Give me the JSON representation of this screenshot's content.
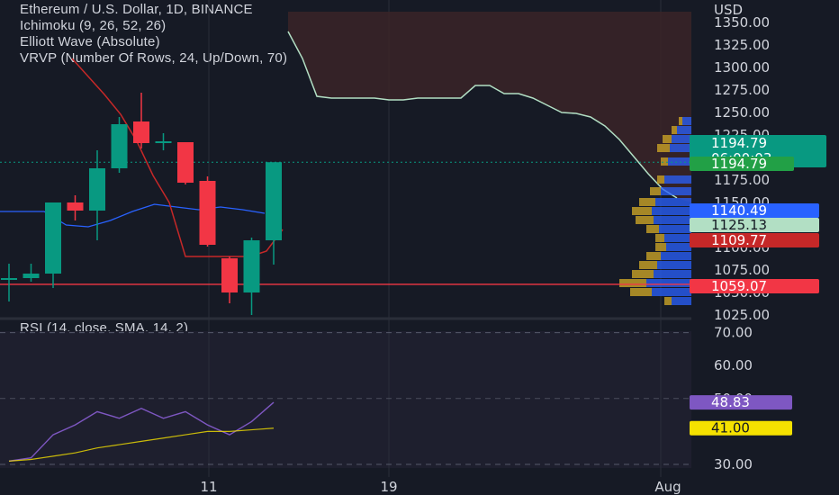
{
  "header": {
    "title": "Ethereum / U.S. Dollar, 1D, BINANCE",
    "indicators": [
      "Ichimoku (9, 26, 52, 26)",
      "Elliott Wave (Absolute)",
      "VRVP (Number Of Rows, 24, Up/Down, 70)"
    ]
  },
  "rsi_label": "RSI (14, close, SMA, 14, 2)",
  "currency": "USD",
  "price_ticks": [
    "1350.00",
    "1325.00",
    "1300.00",
    "1275.00",
    "1250.00",
    "1225.00",
    "1175.00",
    "1150.00",
    "1100.00",
    "1075.00",
    "1050.00",
    "1025.00"
  ],
  "rsi_ticks": [
    "70.00",
    "60.00",
    "50.00",
    "30.00"
  ],
  "x_ticks": [
    "11",
    "19",
    "Aug"
  ],
  "badges": [
    {
      "text": "1194.79",
      "sub": "06:00:03",
      "bg": "#089981",
      "fg": "#ffffff"
    },
    {
      "text": "1194.79",
      "bg": "#22a046",
      "fg": "#ffffff"
    },
    {
      "text": "1140.49",
      "bg": "#2962ff",
      "fg": "#ffffff"
    },
    {
      "text": "1125.13",
      "bg": "#b2dfc4",
      "fg": "#131722"
    },
    {
      "text": "1109.77",
      "bg": "#c62828",
      "fg": "#ffffff"
    },
    {
      "text": "1059.07",
      "bg": "#f23645",
      "fg": "#ffffff"
    }
  ],
  "rsi_badges": [
    {
      "text": "48.83",
      "bg": "#7e57c2",
      "fg": "#ffffff"
    },
    {
      "text": "41.00",
      "bg": "#f5e100",
      "fg": "#131722"
    }
  ],
  "colors": {
    "up": "#089981",
    "down": "#f23645",
    "background": "#161a25",
    "grid": "#2a2e39",
    "axis_text": "#d1d4dc"
  },
  "chart_data": {
    "type": "candlestick",
    "symbol": "Ethereum / U.S. Dollar",
    "timeframe": "1D",
    "exchange": "BINANCE",
    "ylim": [
      1020,
      1362
    ],
    "candles": [
      {
        "o": 1064,
        "h": 1082,
        "l": 1040,
        "c": 1066
      },
      {
        "o": 1066,
        "h": 1082,
        "l": 1062,
        "c": 1071
      },
      {
        "o": 1071,
        "h": 1150,
        "l": 1055,
        "c": 1150
      },
      {
        "o": 1150,
        "h": 1158,
        "l": 1130,
        "c": 1141
      },
      {
        "o": 1141,
        "h": 1208,
        "l": 1108,
        "c": 1188
      },
      {
        "o": 1188,
        "h": 1245,
        "l": 1183,
        "c": 1237
      },
      {
        "o": 1240,
        "h": 1272,
        "l": 1210,
        "c": 1216
      },
      {
        "o": 1216,
        "h": 1227,
        "l": 1208,
        "c": 1218
      },
      {
        "o": 1217,
        "h": 1217,
        "l": 1170,
        "c": 1172
      },
      {
        "o": 1174,
        "h": 1179,
        "l": 1101,
        "c": 1103
      },
      {
        "o": 1088,
        "h": 1090,
        "l": 1038,
        "c": 1050
      },
      {
        "o": 1050,
        "h": 1111,
        "l": 1025,
        "c": 1108
      },
      {
        "o": 1108,
        "h": 1160,
        "l": 1081,
        "c": 1194.79
      }
    ],
    "current_price": 1194.79,
    "levels": {
      "kijun": 1140.49,
      "poc": 1125.13,
      "tenkan": 1109.77,
      "horizontal_line": 1059.07
    },
    "ichimoku_tenkan": [
      1140,
      1140,
      1140,
      1125,
      1123,
      1130,
      1140,
      1148,
      1145,
      1142,
      1145,
      1142,
      1138
    ],
    "red_line": [
      1310,
      1290,
      1270,
      1248,
      1218,
      1180,
      1150,
      1090,
      1090,
      1090,
      1090,
      1090,
      1096,
      1120
    ],
    "cloud_edge": [
      1340,
      1310,
      1268,
      1266,
      1266,
      1266,
      1266,
      1264,
      1264,
      1266,
      1266,
      1266,
      1266,
      1280,
      1280,
      1271,
      1271,
      1266,
      1258,
      1250,
      1249,
      1245,
      1235,
      1220,
      1201,
      1182,
      1165,
      1155
    ],
    "volume_profile": [
      {
        "price": 1240,
        "up": 4,
        "down": 10
      },
      {
        "price": 1230,
        "up": 6,
        "down": 16
      },
      {
        "price": 1220,
        "up": 10,
        "down": 22
      },
      {
        "price": 1210,
        "up": 14,
        "down": 24
      },
      {
        "price": 1195,
        "up": 8,
        "down": 26
      },
      {
        "price": 1175,
        "up": 8,
        "down": 30
      },
      {
        "price": 1162,
        "up": 12,
        "down": 34
      },
      {
        "price": 1150,
        "up": 18,
        "down": 40
      },
      {
        "price": 1140,
        "up": 22,
        "down": 44
      },
      {
        "price": 1130,
        "up": 20,
        "down": 42
      },
      {
        "price": 1120,
        "up": 14,
        "down": 36
      },
      {
        "price": 1110,
        "up": 10,
        "down": 30
      },
      {
        "price": 1100,
        "up": 12,
        "down": 28
      },
      {
        "price": 1090,
        "up": 16,
        "down": 34
      },
      {
        "price": 1080,
        "up": 20,
        "down": 38
      },
      {
        "price": 1070,
        "up": 24,
        "down": 42
      },
      {
        "price": 1060,
        "up": 30,
        "down": 50
      },
      {
        "price": 1050,
        "up": 24,
        "down": 44
      },
      {
        "price": 1040,
        "up": 8,
        "down": 22
      }
    ],
    "rsi": {
      "ylim": [
        28,
        76
      ],
      "values": [
        31,
        32,
        39,
        42,
        46,
        44,
        47,
        44,
        46,
        42,
        39,
        43,
        48.83
      ],
      "sma": [
        31,
        31.5,
        32.5,
        33.5,
        35,
        36,
        37,
        38,
        39,
        40,
        40,
        40.5,
        41
      ]
    }
  }
}
